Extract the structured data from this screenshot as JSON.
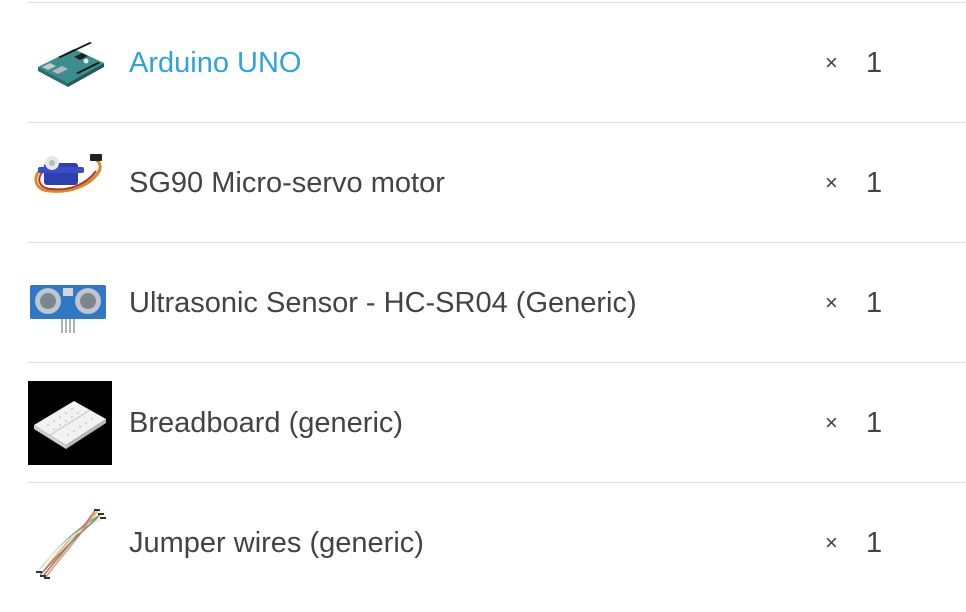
{
  "components": [
    {
      "name": "Arduino UNO",
      "is_link": true,
      "times": "×",
      "qty": "1",
      "icon": "arduino-uno-board-icon"
    },
    {
      "name": "SG90 Micro-servo motor",
      "is_link": false,
      "times": "×",
      "qty": "1",
      "icon": "servo-motor-icon"
    },
    {
      "name": "Ultrasonic Sensor - HC-SR04 (Generic)",
      "is_link": false,
      "times": "×",
      "qty": "1",
      "icon": "ultrasonic-sensor-icon"
    },
    {
      "name": "Breadboard (generic)",
      "is_link": false,
      "times": "×",
      "qty": "1",
      "icon": "breadboard-icon"
    },
    {
      "name": "Jumper wires (generic)",
      "is_link": false,
      "times": "×",
      "qty": "1",
      "icon": "jumper-wires-icon"
    }
  ],
  "colors": {
    "link": "#2ea3dd",
    "text": "#444444",
    "divider": "#e3e3e3"
  }
}
